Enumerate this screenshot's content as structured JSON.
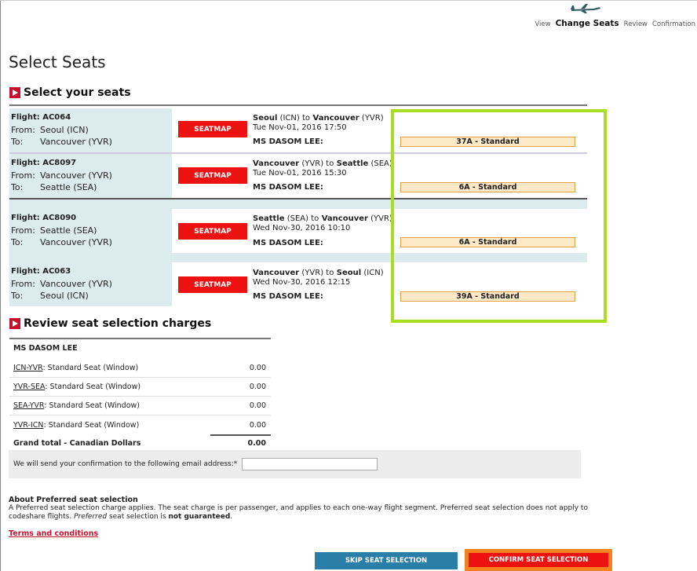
{
  "steps": {
    "view": "View",
    "change_seats": "Change Seats",
    "review": "Review",
    "confirmation": "Confirmation"
  },
  "page_title": "Select Seats",
  "section_select": "Select your seats",
  "section_review": "Review seat selection charges",
  "seatmap_label": "SEATMAP",
  "flights": [
    {
      "flight": "Flight: AC064",
      "from_k": "From:",
      "from_v": "Seoul (ICN)",
      "to_k": "To:",
      "to_v": "Vancouver (YVR)",
      "origin_city": "Seoul",
      "origin_code": " (ICN) ",
      "to_word": "to",
      "dest_city": " Vancouver",
      "dest_code": " (YVR)",
      "datetime": "Tue Nov-01, 2016  17:50",
      "passenger": "MS DASOM LEE:",
      "seat": "37A  -  Standard"
    },
    {
      "flight": "Flight: AC8097",
      "from_k": "From:",
      "from_v": "Vancouver (YVR)",
      "to_k": "To:",
      "to_v": "Seattle (SEA)",
      "origin_city": "Vancouver",
      "origin_code": " (YVR) ",
      "to_word": "to",
      "dest_city": " Seattle",
      "dest_code": " (SEA)",
      "datetime": "Tue Nov-01, 2016  15:30",
      "passenger": "MS DASOM LEE:",
      "seat": "6A    -  Standard"
    },
    {
      "flight": "Flight: AC8090",
      "from_k": "From:",
      "from_v": "Seattle (SEA)",
      "to_k": "To:",
      "to_v": "Vancouver (YVR)",
      "origin_city": "Seattle",
      "origin_code": " (SEA) ",
      "to_word": "to",
      "dest_city": " Vancouver",
      "dest_code": " (YVR)",
      "datetime": "Wed Nov-30, 2016  10:10",
      "passenger": "MS DASOM LEE:",
      "seat": "6A    -  Standard"
    },
    {
      "flight": "Flight: AC063",
      "from_k": "From:",
      "from_v": "Vancouver (YVR)",
      "to_k": "To:",
      "to_v": "Seoul (ICN)",
      "origin_city": "Vancouver",
      "origin_code": " (YVR) ",
      "to_word": "to",
      "dest_city": " Seoul",
      "dest_code": " (ICN)",
      "datetime": "Wed Nov-30, 2016  12:15",
      "passenger": "MS DASOM LEE:",
      "seat": "39A  -  Standard"
    }
  ],
  "charges": {
    "passenger": "MS DASOM LEE",
    "rows": [
      {
        "route": "ICN-YVR",
        "desc": ":  Standard Seat (Window)",
        "amount": "0.00"
      },
      {
        "route": "YVR-SEA",
        "desc": ":  Standard Seat (Window)",
        "amount": "0.00"
      },
      {
        "route": "SEA-YVR",
        "desc": ":  Standard Seat (Window)",
        "amount": "0.00"
      },
      {
        "route": "YVR-ICN",
        "desc": ":  Standard Seat (Window)",
        "amount": "0.00"
      }
    ],
    "grand_label": "Grand total - Canadian Dollars",
    "grand_amount": "0.00"
  },
  "email_label": "We will send your confirmation to the following email address:*",
  "email_value": "",
  "about_title": "About Preferred seat selection",
  "about_text_1": "A Preferred seat selection charge applies. The seat charge is per passenger, and applies to each one-way flight segment. Preferred seat selection does not apply to codeshare flights.",
  "about_text_2": "Preferred",
  "about_text_3": " seat selection is ",
  "about_text_4": "not guaranteed",
  "about_text_5": ".",
  "terms": "Terms and conditions",
  "skip_button": "SKIP SEAT SELECTION",
  "confirm_button": "CONFIRM SEAT SELECTION",
  "colors": {
    "brand_red": "#ee1111",
    "highlight_green": "#a8dd22",
    "skip_blue": "#2a7ea8",
    "confirm_orange": "#f58220"
  }
}
